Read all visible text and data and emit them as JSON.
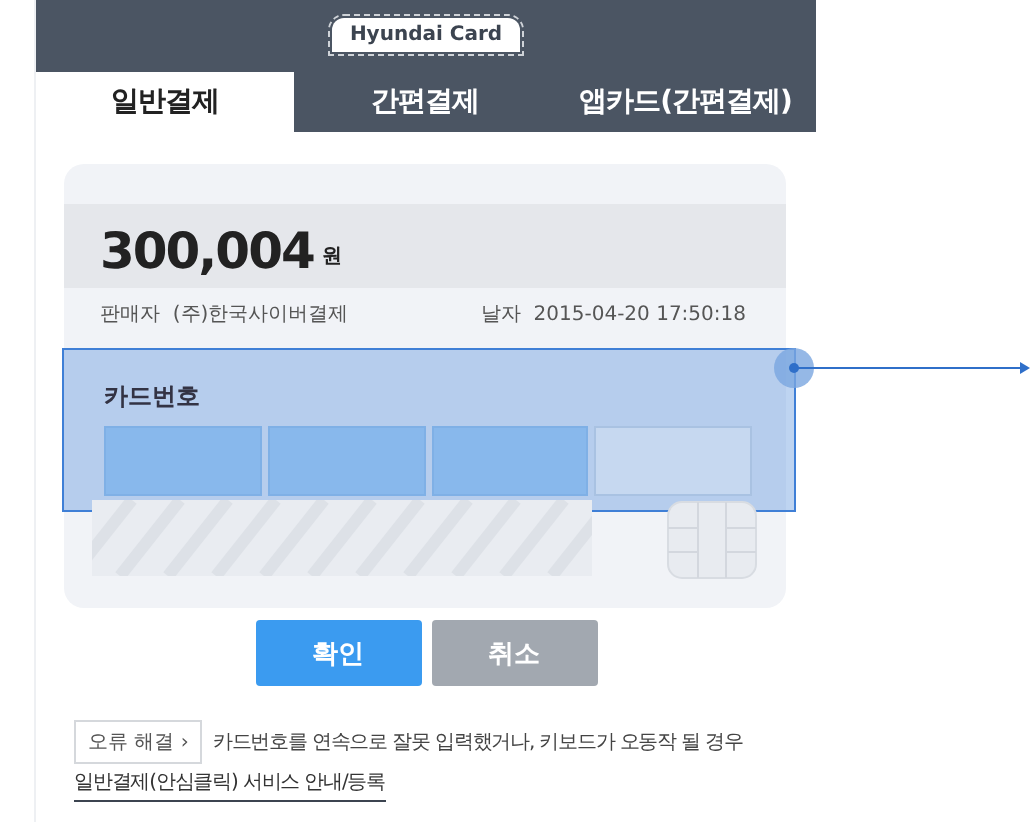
{
  "header": {
    "logo": "Hyundai Card"
  },
  "tabs": [
    {
      "label": "일반결제",
      "selected": true
    },
    {
      "label": "간편결제",
      "selected": false
    },
    {
      "label": "앱카드(간편결제)",
      "selected": false
    }
  ],
  "payment": {
    "amount": "300,004",
    "currency": "원",
    "seller_label": "판매자",
    "seller": "(주)한국사이버결제",
    "date_label": "날자",
    "date": "2015-04-20 17:50:18"
  },
  "card_number": {
    "label": "카드번호",
    "highlighted": true,
    "fields": [
      {
        "filled": true
      },
      {
        "filled": true
      },
      {
        "filled": true
      },
      {
        "filled": false
      }
    ]
  },
  "buttons": [
    {
      "label": "확인",
      "kind": "primary"
    },
    {
      "label": "취소",
      "kind": "secondary"
    }
  ],
  "help": {
    "button": "오류 해결 ›",
    "text": "카드번호를 연속으로 잘못 입력했거나, 키보드가 오동작 될 경우",
    "link": "일반결제(안심클릭) 서비스 안내/등록"
  }
}
